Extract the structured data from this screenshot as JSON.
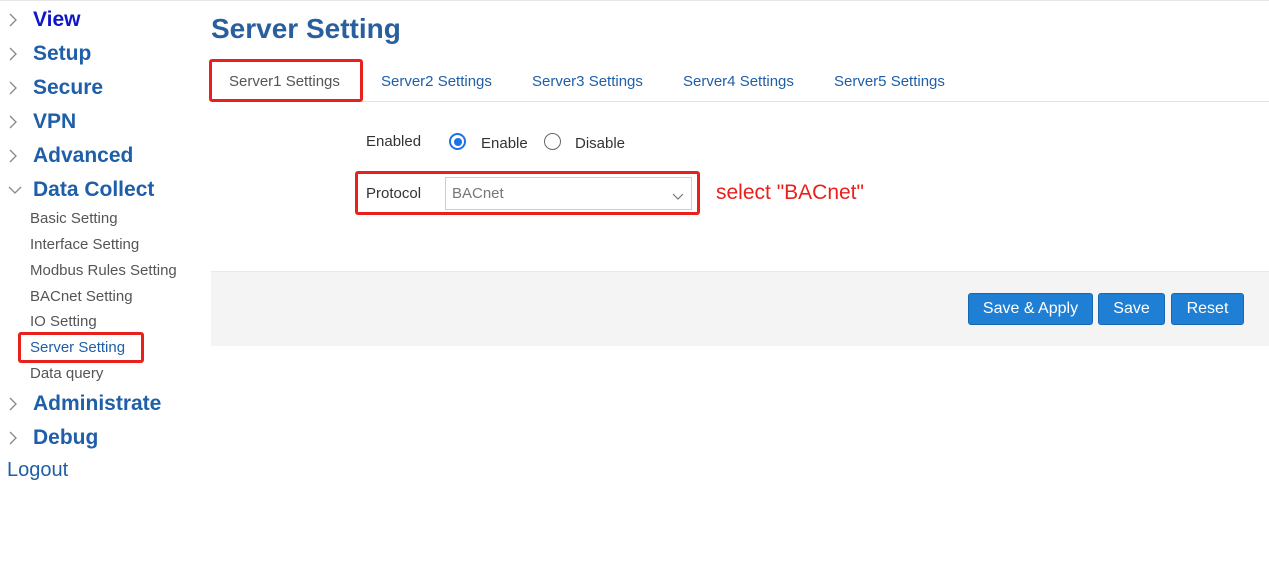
{
  "sidebar": {
    "menu": [
      {
        "label": "View"
      },
      {
        "label": "Setup"
      },
      {
        "label": "Secure"
      },
      {
        "label": "VPN"
      },
      {
        "label": "Advanced"
      },
      {
        "label": "Data Collect"
      },
      {
        "label": "Administrate"
      },
      {
        "label": "Debug"
      }
    ],
    "data_collect_items": [
      {
        "label": "Basic Setting"
      },
      {
        "label": "Interface Setting"
      },
      {
        "label": "Modbus Rules Setting"
      },
      {
        "label": "BACnet Setting"
      },
      {
        "label": "IO Setting"
      },
      {
        "label": "Server Setting"
      },
      {
        "label": "Data query"
      }
    ],
    "logout": "Logout"
  },
  "main": {
    "title": "Server Setting",
    "tabs": [
      {
        "label": "Server1 Settings"
      },
      {
        "label": "Server2 Settings"
      },
      {
        "label": "Server3 Settings"
      },
      {
        "label": "Server4 Settings"
      },
      {
        "label": "Server5 Settings"
      }
    ],
    "enabled": {
      "label": "Enabled",
      "option_enable": "Enable",
      "option_disable": "Disable",
      "selected": "Enable"
    },
    "protocol": {
      "label": "Protocol",
      "value": "BACnet"
    },
    "annotation": "select \"BACnet\"",
    "buttons": {
      "save_apply": "Save & Apply",
      "save": "Save",
      "reset": "Reset"
    }
  },
  "colors": {
    "accent": "#1f5ea8",
    "button": "#1e7fd4",
    "annotation": "#e8211d"
  }
}
